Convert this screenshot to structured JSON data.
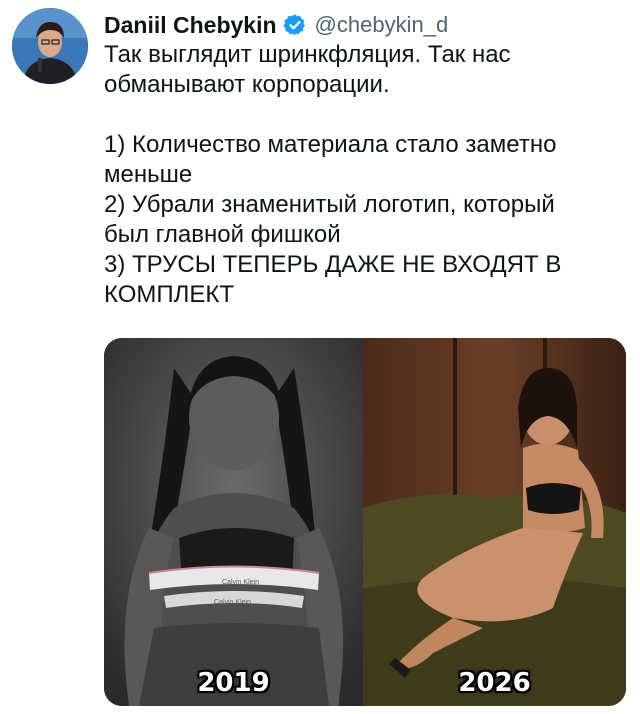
{
  "tweet": {
    "author_name": "Daniil Chebykin",
    "author_handle": "@chebykin_d",
    "text_intro": [
      "Так выглядит шринкфляция. Так нас",
      "обманывают корпорации."
    ],
    "text_points": [
      "1) Количество материала стало заметно",
      "меньше",
      "2) Убрали знаменитый логотип, который",
      "был главной фишкой",
      "3) ТРУСЫ ТЕПЕРЬ ДАЖЕ НЕ ВХОДЯТ В",
      "КОМПЛЕКТ"
    ]
  },
  "media": {
    "left": {
      "year": "2019",
      "waistband_text": "Calvin Klein"
    },
    "right": {
      "year": "2026"
    }
  },
  "icons": {
    "verified": "verified-badge-icon"
  },
  "colors": {
    "verified": "#1d9bf0",
    "handle": "#536471",
    "text": "#0f1419"
  }
}
